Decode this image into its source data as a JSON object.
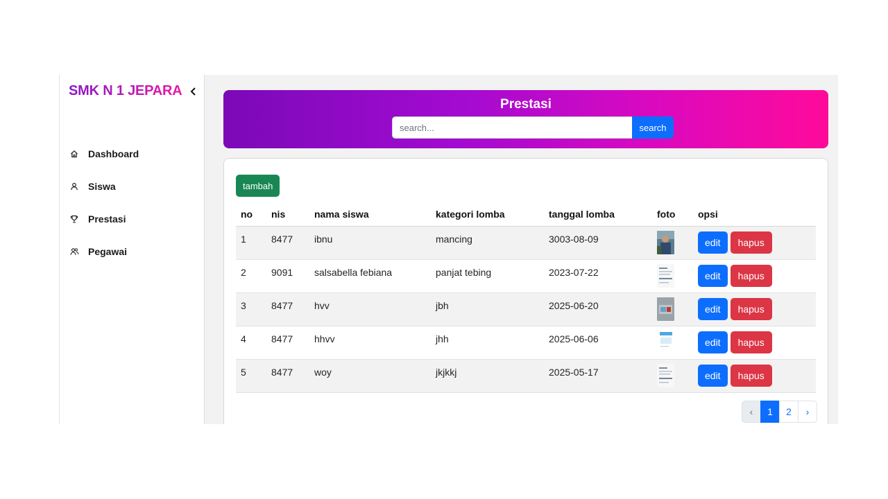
{
  "sidebar": {
    "brand": "SMK N 1 JEPARA",
    "collapse_icon": "chevron-left-icon",
    "items": [
      {
        "label": "Dashboard",
        "icon": "home-icon"
      },
      {
        "label": "Siswa",
        "icon": "user-icon"
      },
      {
        "label": "Prestasi",
        "icon": "trophy-icon"
      },
      {
        "label": "Pegawai",
        "icon": "users-icon"
      }
    ]
  },
  "header": {
    "title": "Prestasi",
    "search_placeholder": "search...",
    "search_button": "search"
  },
  "toolbar": {
    "add_label": "tambah"
  },
  "table": {
    "columns": [
      "no",
      "nis",
      "nama siswa",
      "kategori lomba",
      "tanggal lomba",
      "foto",
      "opsi"
    ],
    "rows": [
      {
        "no": "1",
        "nis": "8477",
        "nama": "ibnu",
        "kategori": "mancing",
        "tanggal": "3003-08-09"
      },
      {
        "no": "2",
        "nis": "9091",
        "nama": "salsabella febiana",
        "kategori": "panjat tebing",
        "tanggal": "2023-07-22"
      },
      {
        "no": "3",
        "nis": "8477",
        "nama": "hvv",
        "kategori": "jbh",
        "tanggal": "2025-06-20"
      },
      {
        "no": "4",
        "nis": "8477",
        "nama": "hhvv",
        "kategori": "jhh",
        "tanggal": "2025-06-06"
      },
      {
        "no": "5",
        "nis": "8477",
        "nama": "woy",
        "kategori": "jkjkkj",
        "tanggal": "2025-05-17"
      }
    ],
    "edit_label": "edit",
    "delete_label": "hapus"
  },
  "pagination": {
    "prev": "‹",
    "pages": [
      "1",
      "2"
    ],
    "active": "1",
    "next": "›"
  },
  "colors": {
    "brand_gradient_start": "#8a16c9",
    "brand_gradient_end": "#e61aa6",
    "primary": "#0d6efd",
    "success": "#198754",
    "danger": "#dc3545"
  }
}
